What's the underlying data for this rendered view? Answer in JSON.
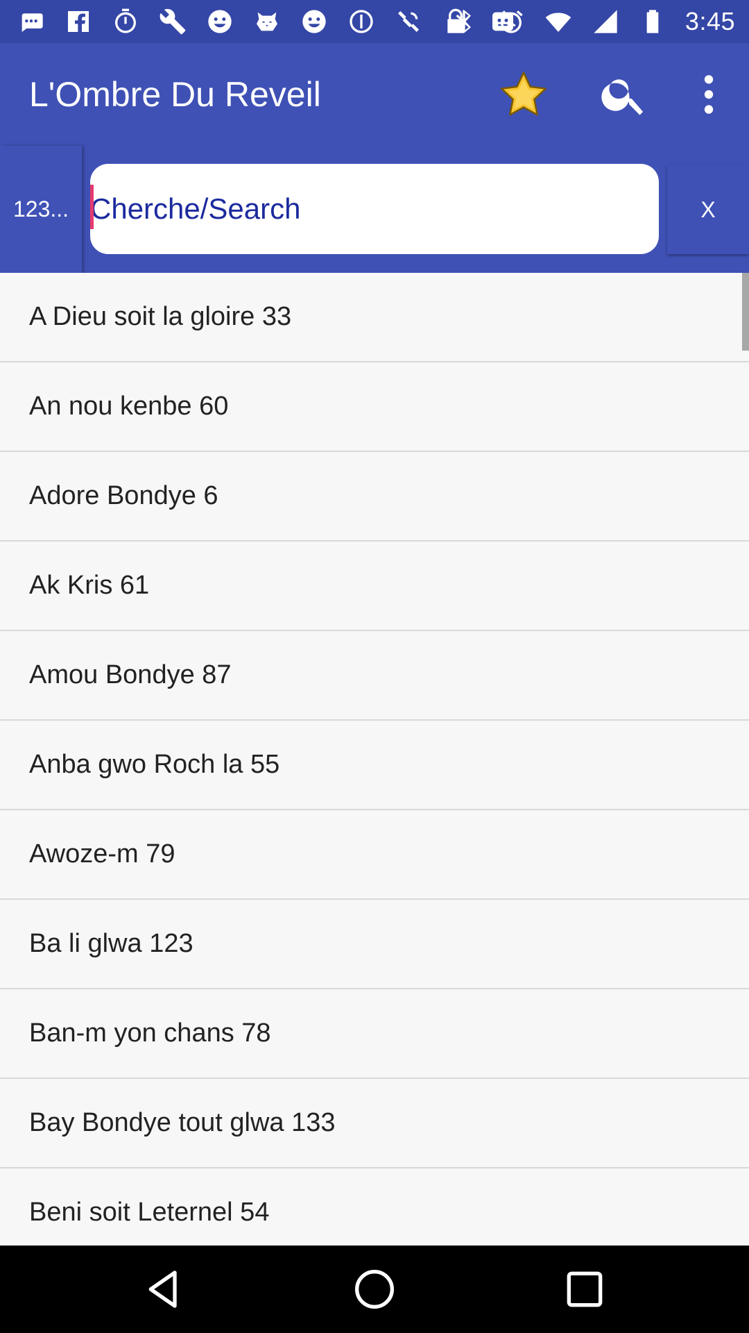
{
  "status_bar": {
    "time": "3:45",
    "left_icons": [
      "message-icon",
      "facebook-icon",
      "timer-icon",
      "wrench-icon",
      "smiley-icon",
      "tiger-icon",
      "smiley-icon",
      "circle-icon",
      "satellite-icon",
      "lock-icon",
      "emoji-icon"
    ],
    "right_icons": [
      "bluetooth-icon",
      "alarm-icon",
      "wifi-icon",
      "signal-icon",
      "battery-icon"
    ]
  },
  "app_bar": {
    "title": "L'Ombre Du Reveil",
    "actions": [
      "star-icon",
      "search-icon",
      "more-vert-icon"
    ]
  },
  "search_row": {
    "number_button_label": "123...",
    "search_placeholder": "Cherche/Search",
    "search_value": "",
    "clear_button_label": "X"
  },
  "songs": [
    "A Dieu soit la gloire 33",
    "An nou kenbe 60",
    "Adore Bondye 6",
    "Ak Kris 61",
    "Amou Bondye 87",
    "Anba gwo Roch la 55",
    "Awoze-m 79",
    "Ba li glwa 123",
    "Ban-m yon chans 78",
    "Bay Bondye tout glwa 133",
    "Beni soit Leternel 54"
  ],
  "colors": {
    "status_bar": "#3446a6",
    "primary": "#3f51b5",
    "star": "#f7c430",
    "cursor": "#e53b6f",
    "search_text": "#1b2a9e"
  },
  "nav_bar": [
    "back-icon",
    "home-icon",
    "recents-icon"
  ]
}
